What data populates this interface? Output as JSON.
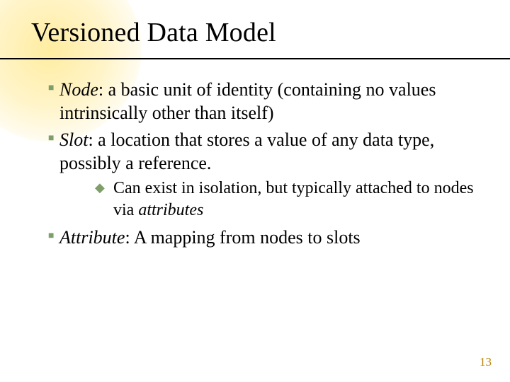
{
  "title": "Versioned Data Model",
  "bullets": [
    {
      "term": "Node",
      "def": ": a basic unit of identity (containing no values intrinsically other than itself)"
    },
    {
      "term": "Slot",
      "def": ": a location that stores a value of any data type, possibly a reference.",
      "sub": {
        "lead": "Can exist in isolation, but typically attached to nodes via ",
        "em": "attributes"
      }
    },
    {
      "term": "Attribute",
      "def": ": A mapping from nodes to slots"
    }
  ],
  "marks": {
    "square": "■",
    "diamond": "◆"
  },
  "page_number": "13"
}
